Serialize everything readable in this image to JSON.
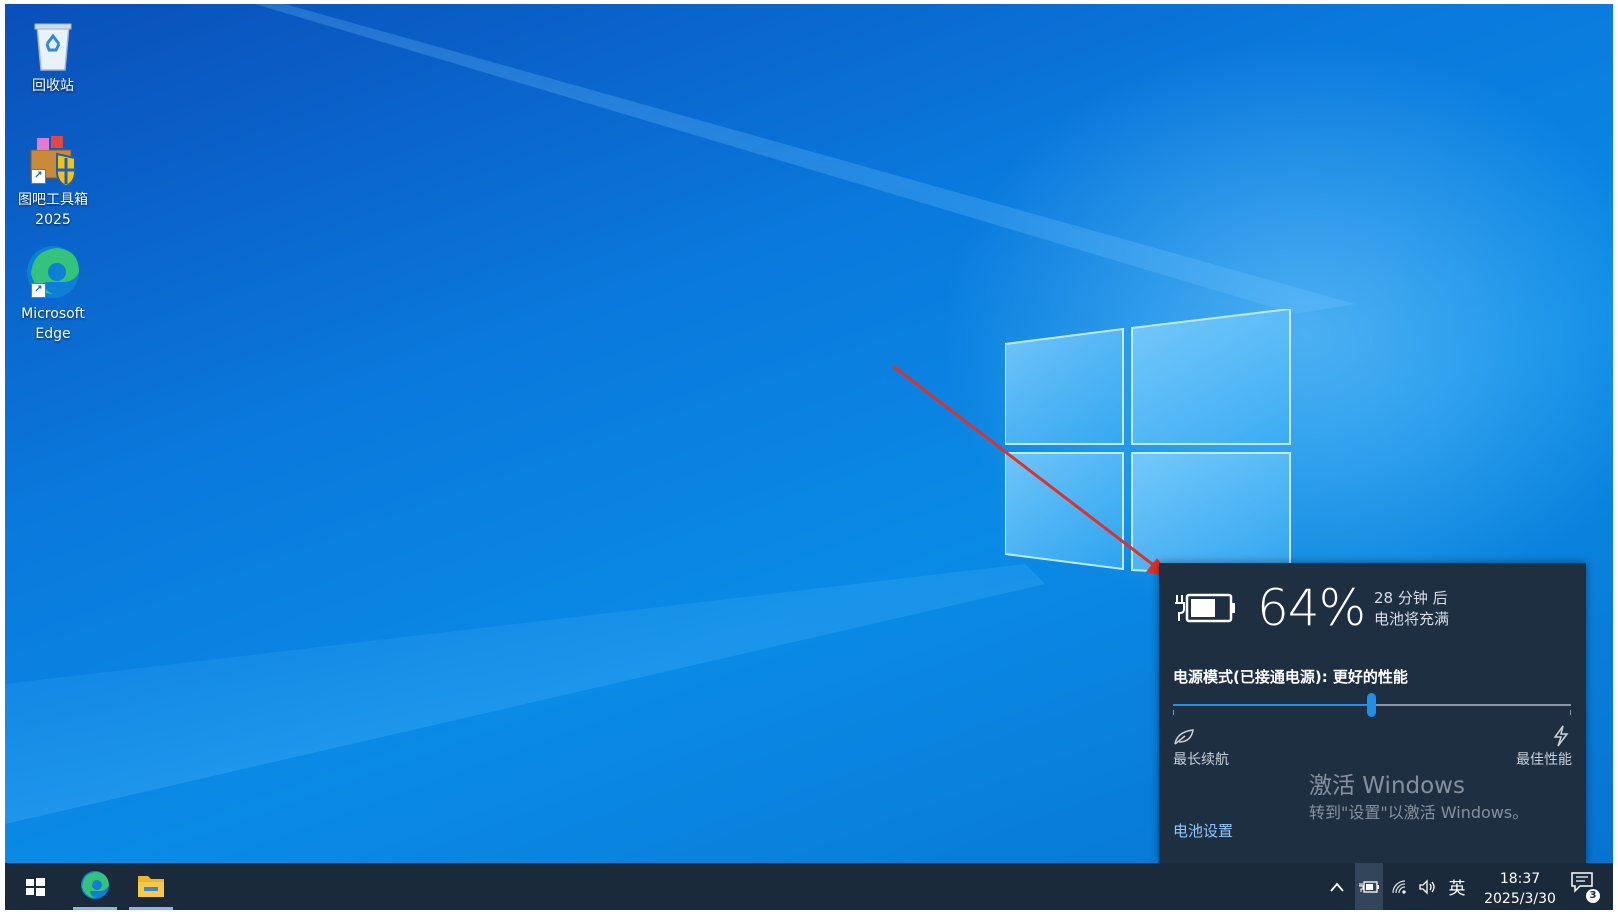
{
  "desktop": {
    "icons": [
      {
        "label": "回收站"
      },
      {
        "label": "图吧工具箱 2025"
      },
      {
        "label": "Microsoft Edge"
      }
    ]
  },
  "battery_flyout": {
    "percent": "64%",
    "percent_value": 64,
    "time_remaining": "28 分钟 后",
    "time_caption": "电池将充满",
    "power_mode_label": "电源模式(已接通电源): 更好的性能",
    "slider_left_label": "最长续航",
    "slider_right_label": "最佳性能",
    "slider_level": 0.5,
    "settings_link": "电池设置"
  },
  "watermark": {
    "title": "激活 Windows",
    "subtitle": "转到\"设置\"以激活 Windows。"
  },
  "taskbar": {
    "ime_label": "英",
    "time": "18:37",
    "date": "2025/3/30",
    "notification_count": "3"
  },
  "colors": {
    "accent": "#1f8fe8",
    "flyout_bg": "#1f2f42",
    "taskbar_bg": "#1b2a3a",
    "arrow": "#e0302a"
  }
}
